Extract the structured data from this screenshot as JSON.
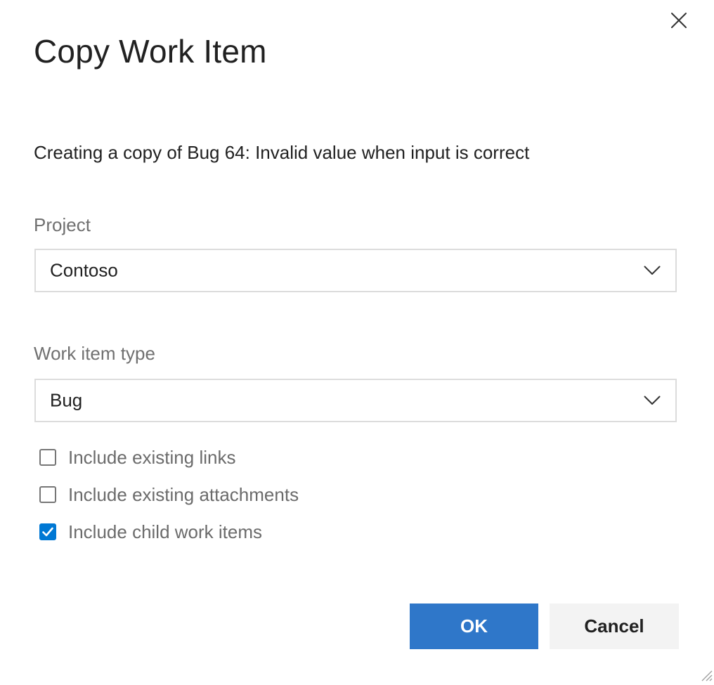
{
  "dialog": {
    "title": "Copy Work Item",
    "description": "Creating a copy of Bug 64: Invalid value when input is correct",
    "close_icon": "close-icon"
  },
  "fields": {
    "project": {
      "label": "Project",
      "value": "Contoso"
    },
    "work_item_type": {
      "label": "Work item type",
      "value": "Bug"
    }
  },
  "options": [
    {
      "label": "Include existing links",
      "checked": false
    },
    {
      "label": "Include existing attachments",
      "checked": false
    },
    {
      "label": "Include child work items",
      "checked": true
    }
  ],
  "buttons": {
    "ok_label": "OK",
    "cancel_label": "Cancel"
  },
  "colors": {
    "primary": "#2f77c9",
    "checkbox_checked": "#0078d4",
    "secondary_button": "#f3f3f3",
    "label_text": "#707070",
    "border": "#dcdcdc"
  }
}
